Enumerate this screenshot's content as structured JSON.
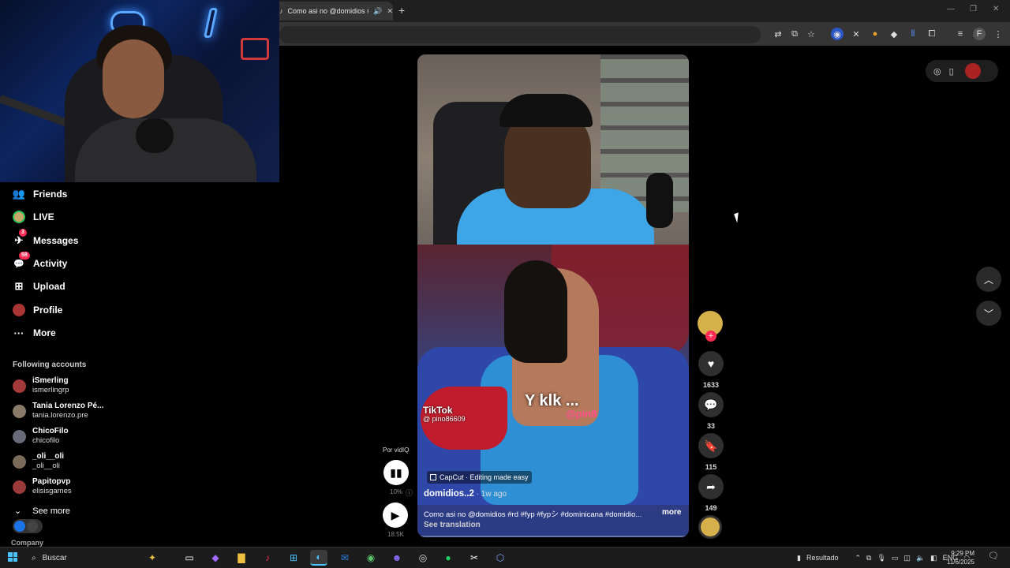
{
  "browser": {
    "tab_title": "Como asi no @domidios #",
    "new_tab": "+",
    "minimize": "—",
    "restore": "❐",
    "close": "✕"
  },
  "sidebar": {
    "items": [
      {
        "label": "Friends",
        "icon": "friends-icon",
        "glyph": "👥"
      },
      {
        "label": "LIVE",
        "icon": "live-avatar-icon"
      },
      {
        "label": "Messages",
        "icon": "messages-icon",
        "glyph": "✈",
        "badge": "3"
      },
      {
        "label": "Activity",
        "icon": "activity-icon",
        "glyph": "💬",
        "badge": "58"
      },
      {
        "label": "Upload",
        "icon": "upload-icon",
        "glyph": "⊞"
      },
      {
        "label": "Profile",
        "icon": "profile-avatar-icon"
      },
      {
        "label": "More",
        "icon": "more-icon",
        "glyph": "···"
      }
    ],
    "following_title": "Following accounts",
    "following": [
      {
        "name": "iSmerling",
        "handle": "ismerlingrp"
      },
      {
        "name": "Tania Lorenzo Pé...",
        "handle": "tania.lorenzo.pre"
      },
      {
        "name": "ChicoFilo",
        "handle": "chicofilo"
      },
      {
        "name": "_oli__oli",
        "handle": "_oli__oli"
      },
      {
        "name": "Papitopvp",
        "handle": "elisisgames"
      }
    ],
    "see_more": "See more",
    "company": "Company"
  },
  "video": {
    "watermark": "TikTok",
    "watermark_handle": "@ pino86609",
    "caption_big": "Y klk ...",
    "caption_at": "@pin8",
    "capcut": "CapCut · Editing made easy",
    "author": "domidios..2",
    "time": " · 1w ago",
    "description": "Como asi no @domidios #rd #fyp #fypシ #dominicana #domidio...",
    "more": "more",
    "see_translation": "See translation"
  },
  "vidiq": {
    "label": "Por vidIQ",
    "percent": "10%",
    "views": "18.5K",
    "info": "ⓘ"
  },
  "actions": {
    "likes": "1633",
    "comments": "33",
    "saves": "115",
    "shares": "149"
  },
  "taskbar": {
    "search": "Buscar",
    "result": "Resultado",
    "lang": "ENG",
    "time": "9:29 PM",
    "date": "11/6/2025"
  }
}
